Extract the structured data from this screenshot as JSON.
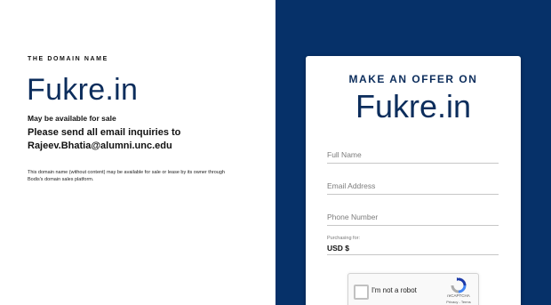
{
  "left": {
    "eyebrow": "THE DOMAIN NAME",
    "domain": "Fukre.in",
    "availability": "May be available for sale",
    "inquiries_line1": "Please send all email inquiries to",
    "inquiries_line2": "Rajeev.Bhatia@alumni.unc.edu",
    "disclaimer": "This domain name (without content) may be available for sale or lease by its owner through Bodis's domain sales platform."
  },
  "offer_card": {
    "heading": "MAKE AN OFFER ON",
    "domain": "Fukre.in",
    "fields": {
      "full_name_placeholder": "Full Name",
      "email_placeholder": "Email Address",
      "phone_placeholder": "Phone Number"
    },
    "purchasing_label": "Purchasing for:",
    "currency_value": "USD $",
    "recaptcha": {
      "label": "I'm not a robot",
      "brand": "reCAPTCHA",
      "terms": "Privacy - Terms"
    }
  },
  "colors": {
    "navy_panel": "#063169",
    "heading_navy": "#0c2d5c"
  },
  "icons": {
    "recaptcha_logo": "recaptcha-logo-icon"
  }
}
